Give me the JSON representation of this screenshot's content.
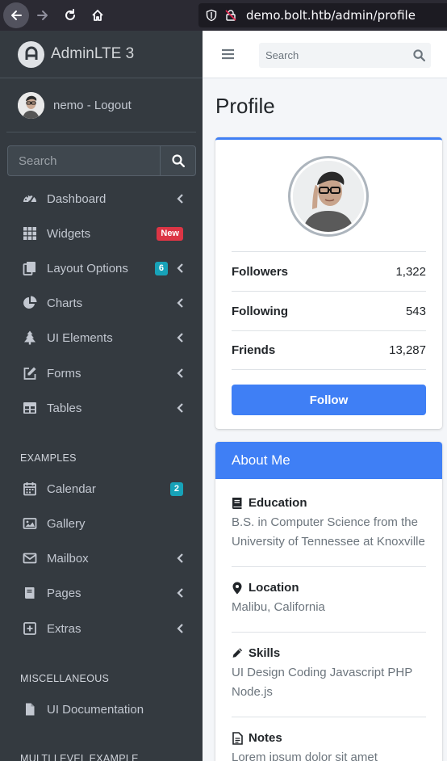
{
  "browser": {
    "url": "demo.bolt.htb/admin/profile"
  },
  "sidebar": {
    "brand": "AdminLTE 3",
    "user": "nemo - Logout",
    "search_placeholder": "Search",
    "items": [
      {
        "label": "Dashboard"
      },
      {
        "label": "Widgets",
        "badge": "New"
      },
      {
        "label": "Layout Options",
        "badge": "6"
      },
      {
        "label": "Charts"
      },
      {
        "label": "UI Elements"
      },
      {
        "label": "Forms"
      },
      {
        "label": "Tables"
      }
    ],
    "examples_header": "EXAMPLES",
    "examples": [
      {
        "label": "Calendar",
        "badge": "2"
      },
      {
        "label": "Gallery"
      },
      {
        "label": "Mailbox"
      },
      {
        "label": "Pages"
      },
      {
        "label": "Extras"
      }
    ],
    "misc_header": "MISCELLANEOUS",
    "misc": [
      {
        "label": "UI Documentation"
      }
    ],
    "multilevel_header": "MULTI LEVEL EXAMPLE"
  },
  "topnav": {
    "search_placeholder": "Search"
  },
  "page": {
    "title": "Profile"
  },
  "profile": {
    "stats": [
      {
        "label": "Followers",
        "value": "1,322"
      },
      {
        "label": "Following",
        "value": "543"
      },
      {
        "label": "Friends",
        "value": "13,287"
      }
    ],
    "follow_label": "Follow"
  },
  "about": {
    "header": "About Me",
    "sections": [
      {
        "title": "Education",
        "text": "B.S. in Computer Science from the University of Tennessee at Knoxville"
      },
      {
        "title": "Location",
        "text": "Malibu, California"
      },
      {
        "title": "Skills",
        "text": "UI Design Coding Javascript PHP Node.js"
      },
      {
        "title": "Notes",
        "text": "Lorem ipsum dolor sit amet"
      }
    ]
  },
  "colors": {
    "sidebar_bg": "#343a40",
    "primary": "#3f7ff5",
    "danger": "#dc3545",
    "info": "#17a2b8"
  }
}
